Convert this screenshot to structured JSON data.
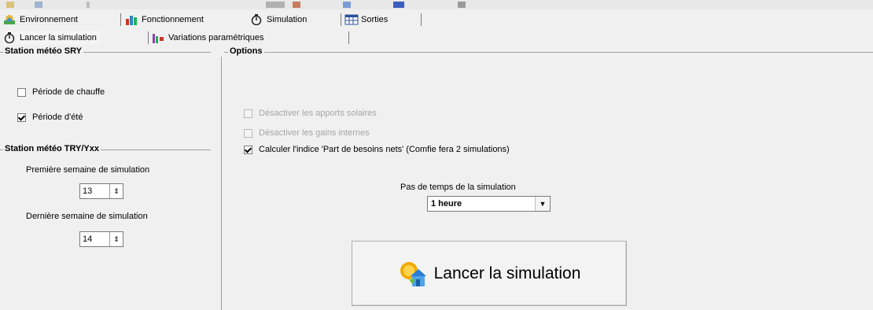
{
  "tabs_main": [
    {
      "label": "Environnement",
      "icon": "environment-icon"
    },
    {
      "label": "Fonctionnement",
      "icon": "building-chart-icon"
    },
    {
      "label": "Simulation",
      "icon": "timer-icon"
    },
    {
      "label": "Sorties",
      "icon": "table-icon"
    }
  ],
  "tabs_sub": [
    {
      "label": "Lancer la simulation",
      "icon": "timer-icon"
    },
    {
      "label": "Variations paramétriques",
      "icon": "bar-chart-icon"
    }
  ],
  "left": {
    "sry_title": "Station météo SRY",
    "periode_chauffe": {
      "label": "Période de chauffe",
      "checked": false
    },
    "periode_ete": {
      "label": "Période d'été",
      "checked": true
    },
    "try_title": "Station météo TRY/Yxx",
    "first_week_label": "Première semaine de simulation",
    "first_week_value": "13",
    "last_week_label": "Dernière semaine de simulation",
    "last_week_value": "14"
  },
  "options": {
    "title": "Options",
    "desactiver_apports": {
      "label": "Désactiver les apports solaires",
      "checked": false,
      "enabled": false
    },
    "desactiver_gains": {
      "label": "Désactiver les gains internes",
      "checked": false,
      "enabled": false
    },
    "calculer_indice": {
      "label": "Calculer l'indice 'Part de besoins nets' (Comfie fera 2 simulations)",
      "checked": true,
      "enabled": true
    },
    "pas_temps_label": "Pas de temps de la simulation",
    "pas_temps_value": "1 heure"
  },
  "launch_button": {
    "label": "Lancer la simulation",
    "icon": "sun-house-icon"
  },
  "colors": {
    "background": "#f0f0f0",
    "group_line": "#a0a0a0",
    "disabled_text": "#a6a6a6"
  }
}
